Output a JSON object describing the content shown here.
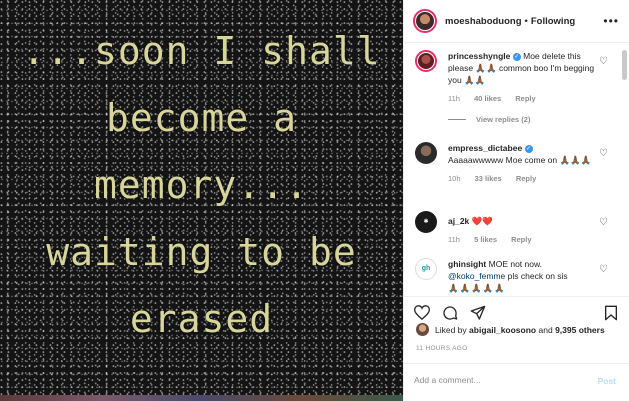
{
  "image": {
    "lines": [
      "...soon I shall",
      "become a",
      "memory...",
      "waiting to be",
      "erased"
    ]
  },
  "header": {
    "username": "moeshaboduong",
    "separator": "•",
    "follow_label": "Following",
    "more_icon": "ellipsis-icon"
  },
  "comments": [
    {
      "username": "princesshyngle",
      "verified": true,
      "text": "Moe delete this please 🙏🏾🙏🏾 common boo I'm begging you 🙏🏾🙏🏾",
      "time": "11h",
      "likes": "40 likes",
      "reply": "Reply",
      "view_replies": "View replies (2)"
    },
    {
      "username": "empress_dictabee",
      "verified": true,
      "text": "Aaaaawwwww Moe come on 🙏🏾🙏🏾🙏🏾",
      "time": "10h",
      "likes": "33 likes",
      "reply": "Reply"
    },
    {
      "username": "aj_2k",
      "verified": false,
      "text": "❤️❤️",
      "time": "11h",
      "likes": "5 likes",
      "reply": "Reply"
    },
    {
      "username": "ghinsight",
      "verified": false,
      "text_a": "MOE not now.",
      "mention": "@koko_femme",
      "text_b": "pls check on sis",
      "text_c": "🙏🏾🙏🏾🙏🏾🙏🏾🙏🏾"
    }
  ],
  "likes": {
    "prefix": "Liked by",
    "user": "abigail_koosono",
    "conj": "and",
    "others": "9,395 others"
  },
  "timestamp": "11 HOURS AGO",
  "input": {
    "placeholder": "Add a comment..."
  },
  "post_label": "Post",
  "colors": {
    "verified": "#3897f0",
    "post_disabled": "#b2dffc",
    "poem_text": "#d8d59a"
  }
}
